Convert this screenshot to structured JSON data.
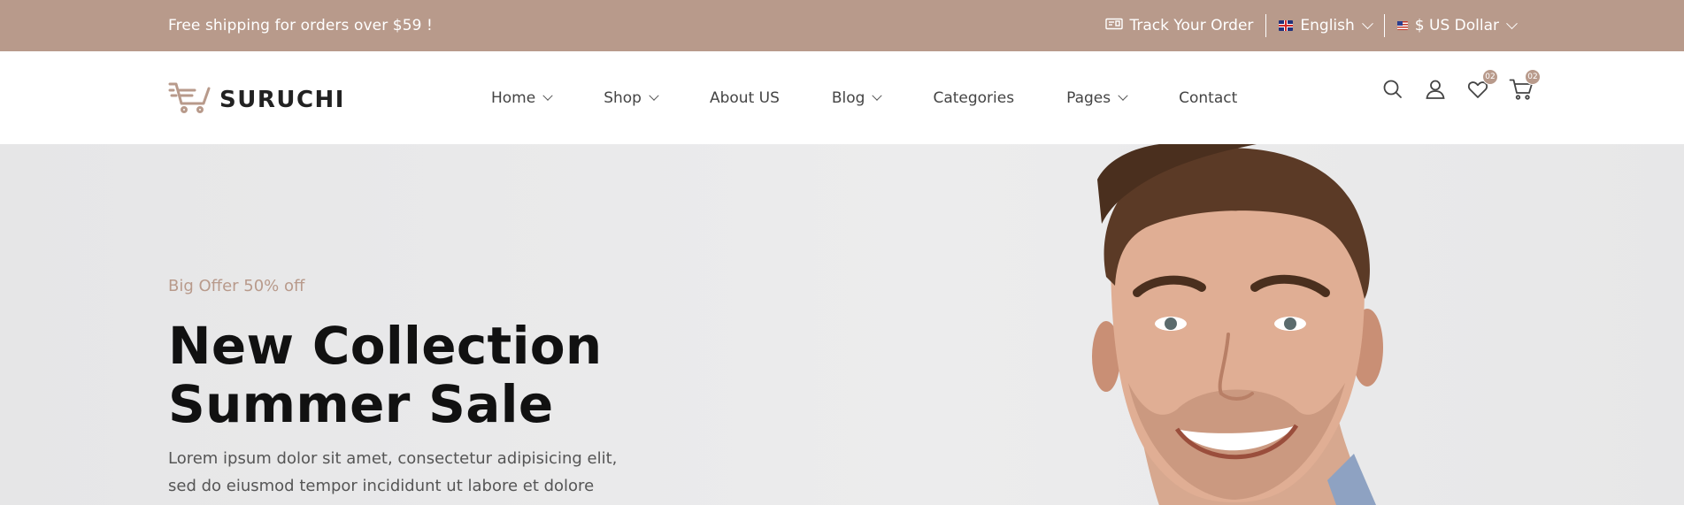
{
  "topbar": {
    "promo": "Free shipping for orders over $59 !",
    "track_order": "Track Your Order",
    "language": "English",
    "currency": "$ US Dollar"
  },
  "header": {
    "logo_text": "SURUCHI",
    "nav": [
      {
        "label": "Home",
        "has_dropdown": true
      },
      {
        "label": "Shop",
        "has_dropdown": true
      },
      {
        "label": "About US",
        "has_dropdown": false
      },
      {
        "label": "Blog",
        "has_dropdown": true
      },
      {
        "label": "Categories",
        "has_dropdown": false
      },
      {
        "label": "Pages",
        "has_dropdown": true
      },
      {
        "label": "Contact",
        "has_dropdown": false
      }
    ],
    "wishlist_count": "02",
    "cart_count": "02"
  },
  "hero": {
    "offer": "Big Offer 50% off",
    "title_line1": "New Collection",
    "title_line2": "Summer Sale",
    "description": "Lorem ipsum dolor sit amet, consectetur adipisicing elit, sed do eiusmod tempor incididunt ut labore et dolore magna"
  },
  "colors": {
    "accent": "#b89a8b",
    "hero_bg": "#e9e9ea",
    "heading": "#111111"
  },
  "icons": [
    "truck-icon",
    "uk-flag-icon",
    "us-flag-icon",
    "search-icon",
    "user-icon",
    "heart-icon",
    "cart-icon",
    "logo-cart-icon"
  ]
}
